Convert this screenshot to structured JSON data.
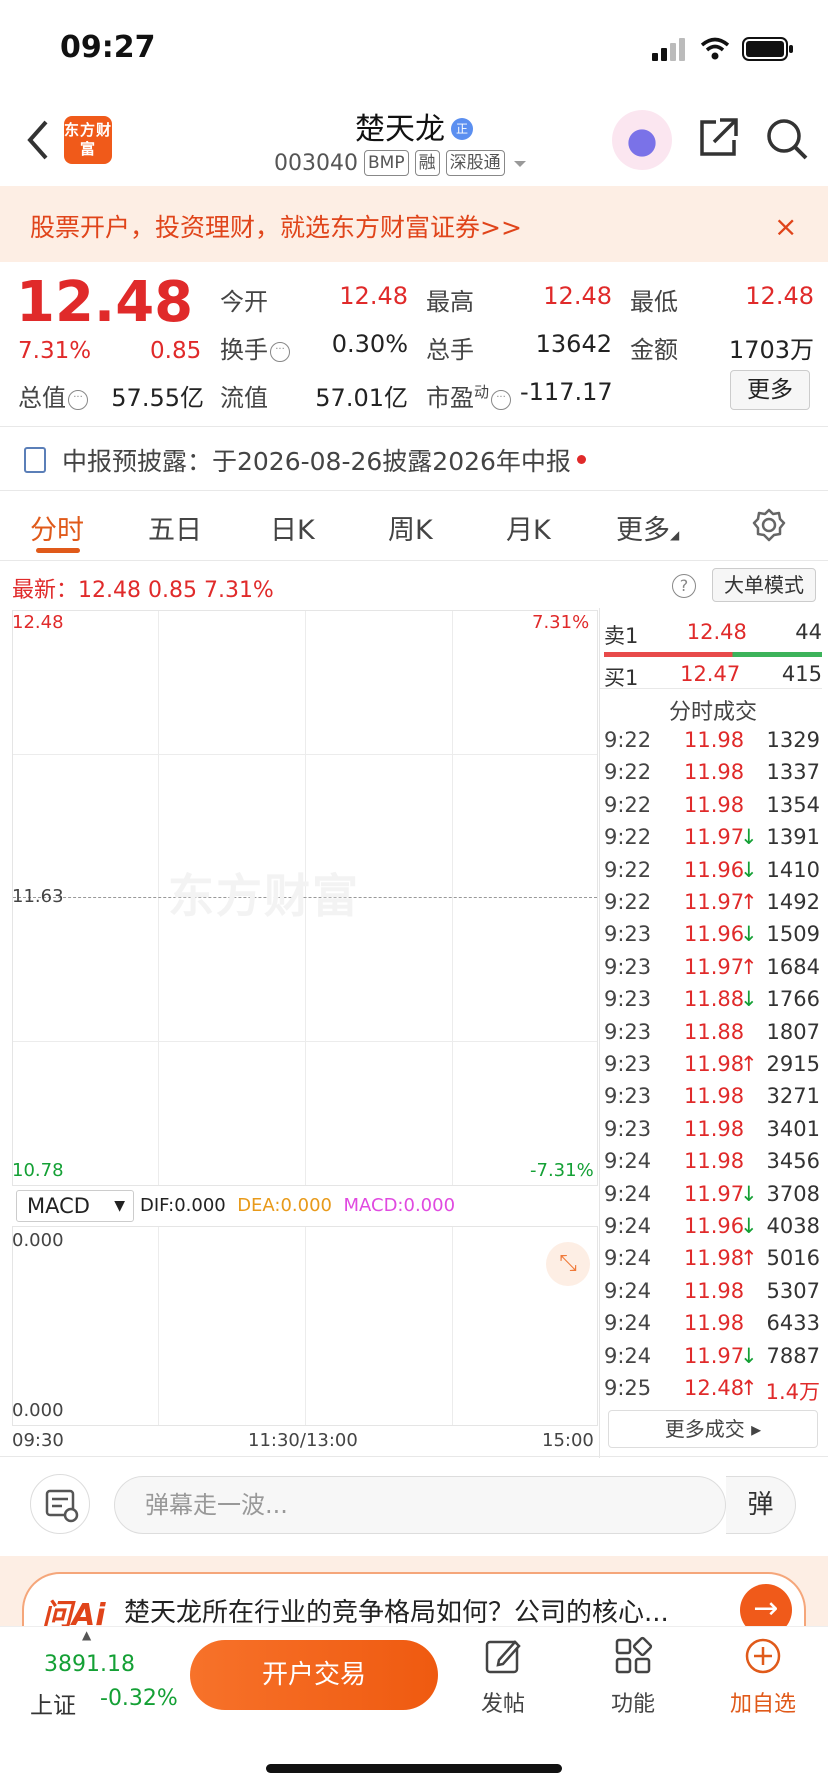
{
  "status": {
    "time": "09:27"
  },
  "header": {
    "logo": "东方财富",
    "stock_name": "楚天龙",
    "name_badge": "正",
    "code": "003040",
    "tags": [
      "BMP",
      "融",
      "深股通"
    ]
  },
  "promo": {
    "text": "股票开户，投资理财，就选东方财富证券>>",
    "close": "×"
  },
  "quote": {
    "price": "12.48",
    "change_pct": "7.31%",
    "change": "0.85",
    "open_label": "今开",
    "open": "12.48",
    "high_label": "最高",
    "high": "12.48",
    "low_label": "最低",
    "low": "12.48",
    "turnover_label": "换手",
    "turnover": "0.30%",
    "volume_label": "总手",
    "volume": "13642",
    "amount_label": "金额",
    "amount": "1703万",
    "mcap_label": "总值",
    "mcap": "57.55亿",
    "float_label": "流值",
    "float_mcap": "57.01亿",
    "pe_label": "市盈",
    "pe_sup": "动",
    "pe": "-117.17",
    "more_label": "更多"
  },
  "disclosure": {
    "text": "中报预披露：于2026-08-26披露2026年中报"
  },
  "tabs": [
    {
      "label": "分时",
      "active": true
    },
    {
      "label": "五日"
    },
    {
      "label": "日K"
    },
    {
      "label": "周K"
    },
    {
      "label": "月K"
    },
    {
      "label": "更多"
    }
  ],
  "latest": {
    "label": "最新：12.48  0.85  7.31%",
    "help": "?",
    "big_order_btn": "大单模式"
  },
  "chart": {
    "y_top": "12.48",
    "y_mid": "11.63",
    "y_bottom": "10.78",
    "pct_top": "7.31%",
    "pct_bottom": "-7.31%",
    "watermark": "东方财富",
    "macd_select": "MACD",
    "dif": "DIF:0.000",
    "dea": "DEA:0.000",
    "macd": "MACD:0.000",
    "macd_top": "0.000",
    "macd_bottom": "0.000",
    "x_start": "09:30",
    "x_mid": "11:30/13:00",
    "x_end": "15:00"
  },
  "order_book": {
    "sell": {
      "label": "卖1",
      "price": "12.48",
      "vol": "44"
    },
    "buy": {
      "label": "买1",
      "price": "12.47",
      "vol": "415"
    },
    "trade_title": "分时成交",
    "trades": [
      {
        "time": "9:22",
        "price": "11.98",
        "arrow": "",
        "vol": "1329"
      },
      {
        "time": "9:22",
        "price": "11.98",
        "arrow": "",
        "vol": "1337"
      },
      {
        "time": "9:22",
        "price": "11.98",
        "arrow": "",
        "vol": "1354"
      },
      {
        "time": "9:22",
        "price": "11.97",
        "arrow": "↓",
        "vol": "1391"
      },
      {
        "time": "9:22",
        "price": "11.96",
        "arrow": "↓",
        "vol": "1410"
      },
      {
        "time": "9:22",
        "price": "11.97",
        "arrow": "↑",
        "vol": "1492"
      },
      {
        "time": "9:23",
        "price": "11.96",
        "arrow": "↓",
        "vol": "1509"
      },
      {
        "time": "9:23",
        "price": "11.97",
        "arrow": "↑",
        "vol": "1684"
      },
      {
        "time": "9:23",
        "price": "11.88",
        "arrow": "↓",
        "vol": "1766"
      },
      {
        "time": "9:23",
        "price": "11.88",
        "arrow": "",
        "vol": "1807"
      },
      {
        "time": "9:23",
        "price": "11.98",
        "arrow": "↑",
        "vol": "2915"
      },
      {
        "time": "9:23",
        "price": "11.98",
        "arrow": "",
        "vol": "3271"
      },
      {
        "time": "9:23",
        "price": "11.98",
        "arrow": "",
        "vol": "3401"
      },
      {
        "time": "9:24",
        "price": "11.98",
        "arrow": "",
        "vol": "3456"
      },
      {
        "time": "9:24",
        "price": "11.97",
        "arrow": "↓",
        "vol": "3708"
      },
      {
        "time": "9:24",
        "price": "11.96",
        "arrow": "↓",
        "vol": "4038"
      },
      {
        "time": "9:24",
        "price": "11.98",
        "arrow": "↑",
        "vol": "5016"
      },
      {
        "time": "9:24",
        "price": "11.98",
        "arrow": "",
        "vol": "5307"
      },
      {
        "time": "9:24",
        "price": "11.98",
        "arrow": "",
        "vol": "6433"
      },
      {
        "time": "9:24",
        "price": "11.97",
        "arrow": "↓",
        "vol": "7887"
      },
      {
        "time": "9:25",
        "price": "12.48",
        "arrow": "↑",
        "vol": "1.4万"
      }
    ],
    "more_trades": "更多成交 ▸"
  },
  "comment": {
    "placeholder": "弹幕走一波...",
    "danmu": "弹"
  },
  "ai": {
    "logo": "问Ai",
    "text": "楚天龙所在行业的竞争格局如何？公司的核心...",
    "go": "→"
  },
  "bottom": {
    "index_value": "3891.18",
    "index_name": "上证",
    "index_change": "-0.32%",
    "open_trade": "开户交易",
    "nav": [
      {
        "label": "发帖",
        "icon": "edit-icon"
      },
      {
        "label": "功能",
        "icon": "grid-icon"
      },
      {
        "label": "加自选",
        "icon": "plus-circle-icon"
      }
    ]
  },
  "colors": {
    "up": "#e02a2a",
    "down": "#14a035",
    "accent": "#f05a1a"
  }
}
